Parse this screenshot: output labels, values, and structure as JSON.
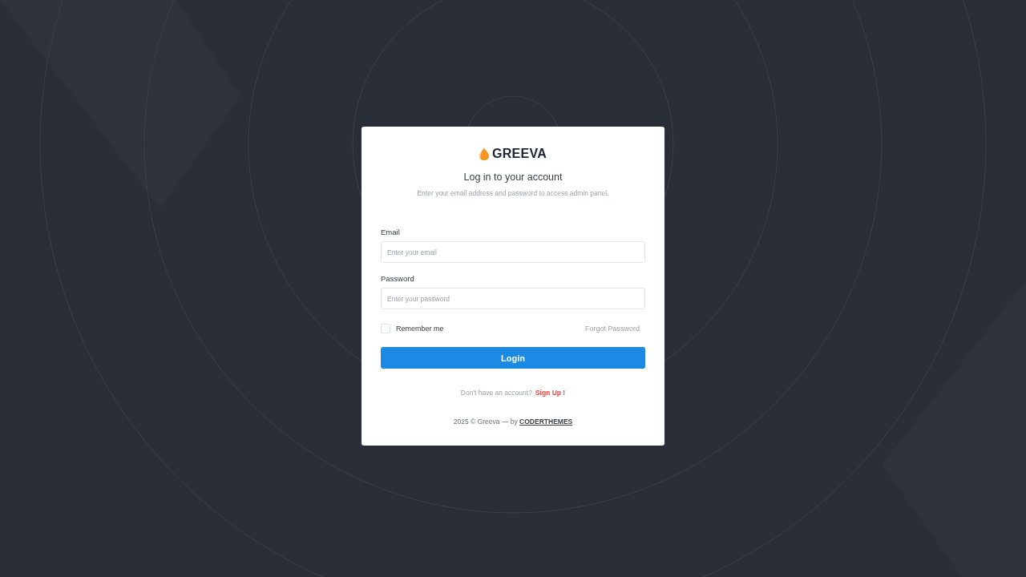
{
  "brand": {
    "name": "GREEVA"
  },
  "heading": "Log in to your account",
  "subtitle": "Enter your email address and password to access admin panel.",
  "fields": [
    {
      "label": "Email",
      "placeholder": "Enter your email"
    },
    {
      "label": "Password",
      "placeholder": "Enter your password"
    }
  ],
  "remember": {
    "label": "Remember me",
    "checked": false
  },
  "forgot_link": "Forgot Password",
  "login_button": "Login",
  "signup": {
    "prompt": "Don't have an account?",
    "link": "Sign Up !"
  },
  "footer": {
    "text": "2025 © Greeva — by",
    "link": "CODERTHEMES"
  }
}
